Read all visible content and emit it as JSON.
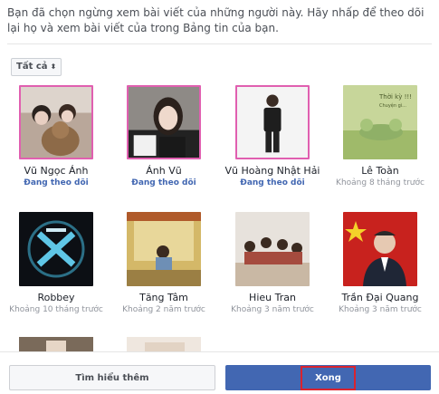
{
  "intro_text": "Bạn đã chọn ngừng xem bài viết của những người này. Hãy nhấp để theo dõi lại họ và xem bài viết của trong Bảng tin của bạn.",
  "filter": {
    "label": "Tất cả",
    "icon": "sort-icon"
  },
  "people": [
    {
      "name": "Vũ Ngọc Ánh",
      "status": "Đang theo dõi",
      "following": true
    },
    {
      "name": "Ánh Vũ",
      "status": "Đang theo dõi",
      "following": true
    },
    {
      "name": "Vũ Hoàng Nhật Hải",
      "status": "Đang theo dõi",
      "following": true
    },
    {
      "name": "Lê Toàn",
      "status": "Khoảng 8 tháng trước",
      "following": false
    },
    {
      "name": "Robbey",
      "status": "Khoảng 10 tháng trước",
      "following": false
    },
    {
      "name": "Tăng Tâm",
      "status": "Khoảng 2 năm trước",
      "following": false
    },
    {
      "name": "Hieu Tran",
      "status": "Khoảng 3 năm trước",
      "following": false
    },
    {
      "name": "Trần Đại Quang",
      "status": "Khoảng 3 năm trước",
      "following": false
    }
  ],
  "footer": {
    "learn_more": "Tìm hiểu thêm",
    "done": "Xong"
  },
  "colors": {
    "accent": "#4267b2",
    "selected_border": "#e05fb0",
    "highlight_box": "#d9232e"
  }
}
